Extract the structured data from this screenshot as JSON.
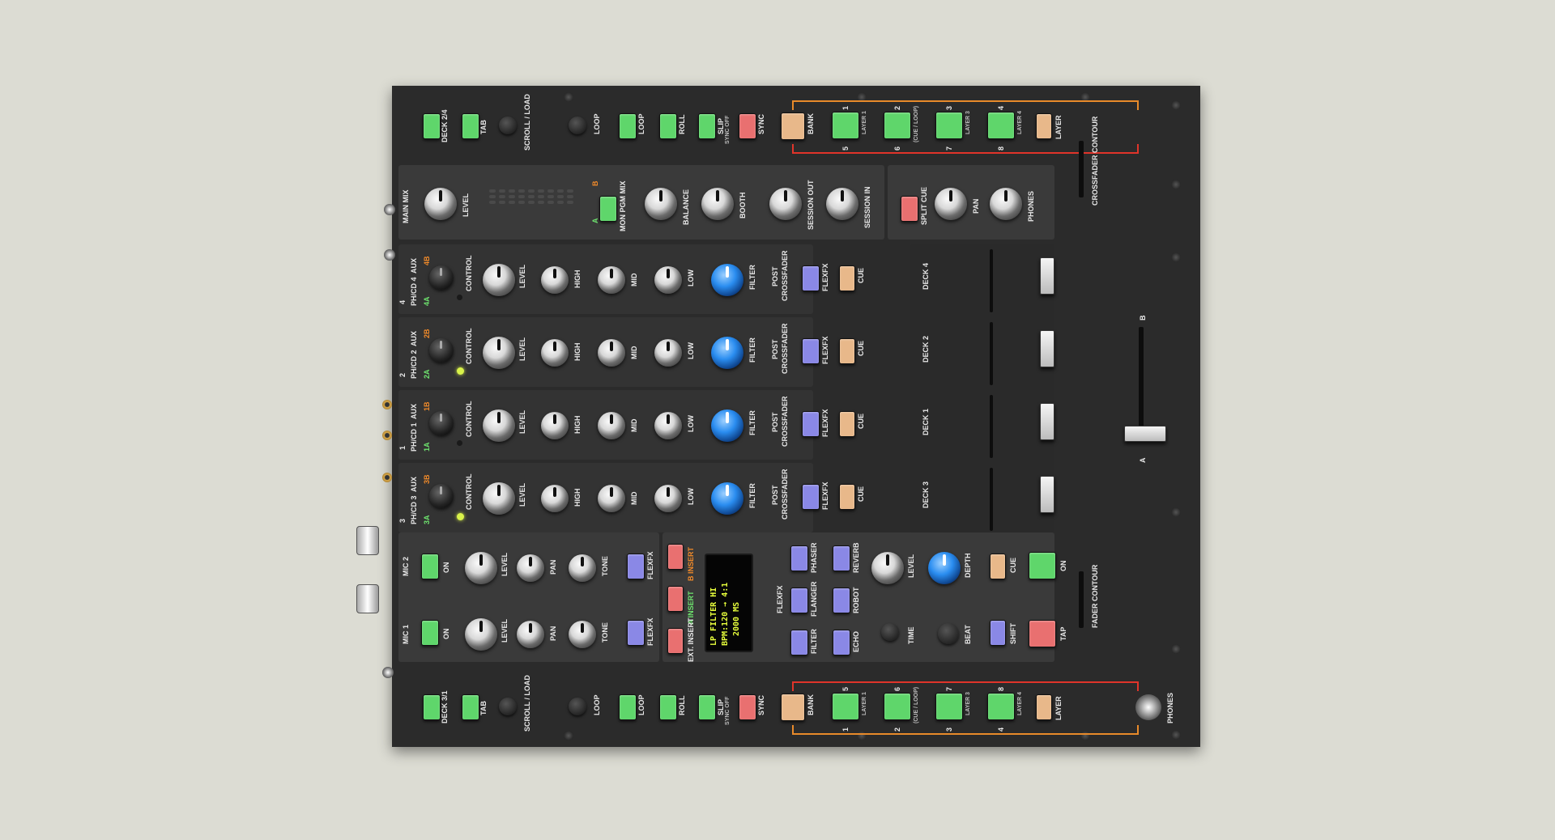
{
  "colors": {
    "accent_green": "#5fd66b",
    "accent_peach": "#e8b88a",
    "accent_red": "#e97070",
    "accent_purple": "#8a88e6",
    "accent_blue": "#2a8df0",
    "bracket_orange": "#e88a2a",
    "bracket_red": "#e0342a",
    "display_yellow": "#e8ff3c"
  },
  "top_deck": {
    "deck_label": "DECK 2/4",
    "tab": "TAB",
    "scroll": "SCROLL / LOAD",
    "loop": "LOOP",
    "loop2": "LOOP",
    "roll": "ROLL",
    "slip": "SLIP",
    "slip_sub": "SYNC OFF",
    "sync": "SYNC",
    "bank": "BANK",
    "pads": [
      {
        "top": "1",
        "bottom": "5",
        "sub": "LAYER 1"
      },
      {
        "top": "2",
        "bottom": "6",
        "sub": "(CUE / LOOP)"
      },
      {
        "top": "3",
        "bottom": "7",
        "sub": "LAYER 3"
      },
      {
        "top": "4",
        "bottom": "8",
        "sub": "LAYER 4"
      }
    ],
    "layer": "LAYER"
  },
  "bottom_deck": {
    "deck_label": "DECK 3/1",
    "tab": "TAB",
    "scroll": "SCROLL / LOAD",
    "loop": "LOOP",
    "loop2": "LOOP",
    "roll": "ROLL",
    "slip": "SLIP",
    "slip_sub": "SYNC OFF",
    "sync": "SYNC",
    "bank": "BANK",
    "pads": [
      {
        "top": "5",
        "bottom": "1",
        "sub": "LAYER 1"
      },
      {
        "top": "6",
        "bottom": "2",
        "sub": "(CUE / LOOP)"
      },
      {
        "top": "7",
        "bottom": "3",
        "sub": "LAYER 3"
      },
      {
        "top": "8",
        "bottom": "4",
        "sub": "LAYER 4"
      }
    ],
    "layer": "LAYER",
    "phones": "PHONES"
  },
  "master": {
    "main_mix": "MAIN MIX",
    "level": "LEVEL",
    "mon_pgm_mix": "MON PGM MIX",
    "src_a": "A",
    "src_b": "B",
    "balance": "BALANCE",
    "booth": "BOOTH",
    "session_out": "SESSION OUT",
    "session_in": "SESSION IN",
    "split_cue": "SPLIT CUE",
    "pan": "PAN",
    "phones": "PHONES",
    "crossfader_contour": "CROSSFADER CONTOUR"
  },
  "channels": [
    {
      "num": "4",
      "src": "PH/CD 4",
      "aux": "AUX",
      "tag_top": "4B",
      "tag_bottom": "4A",
      "control": "CONTROL",
      "led_on": false
    },
    {
      "num": "2",
      "src": "PH/CD 2",
      "aux": "AUX",
      "tag_top": "2B",
      "tag_bottom": "2A",
      "control": "CONTROL",
      "led_on": true
    },
    {
      "num": "1",
      "src": "PH/CD 1",
      "aux": "AUX",
      "tag_top": "1B",
      "tag_bottom": "1A",
      "control": "CONTROL",
      "led_on": false
    },
    {
      "num": "3",
      "src": "PH/CD 3",
      "aux": "AUX",
      "tag_top": "3B",
      "tag_bottom": "3A",
      "control": "CONTROL",
      "led_on": true
    }
  ],
  "strip": {
    "level": "LEVEL",
    "high": "HIGH",
    "mid": "MID",
    "low": "LOW",
    "filter": "FILTER",
    "post": "POST",
    "crossfader": "CROSSFADER",
    "flexfx": "FLEXFX",
    "cue": "CUE",
    "a": "A",
    "b": "B"
  },
  "decks": [
    "DECK 4",
    "DECK 2",
    "DECK 1",
    "DECK 3"
  ],
  "xfader": {
    "a": "A",
    "b": "B"
  },
  "mics": [
    {
      "name": "MIC 2",
      "on": "ON",
      "level": "LEVEL",
      "pan": "PAN",
      "tone": "TONE",
      "flexfx": "FLEXFX"
    },
    {
      "name": "MIC 1",
      "on": "ON",
      "level": "LEVEL",
      "pan": "PAN",
      "tone": "TONE",
      "flexfx": "FLEXFX"
    }
  ],
  "fx": {
    "insert_a": "A INSERT",
    "insert_b": "B INSERT",
    "ext_insert": "EXT. INSERT",
    "display_lines": [
      "LP FILTER HI",
      "BPM:120 → 4:1",
      "2000 MS"
    ],
    "flexfx": "FLEXFX",
    "phaser": "PHASER",
    "reverb": "REVERB",
    "flanger": "FLANGER",
    "robot": "ROBOT",
    "filter": "FILTER",
    "echo": "ECHO",
    "level": "LEVEL",
    "depth": "DEPTH",
    "cue": "CUE",
    "on": "ON",
    "time": "TIME",
    "beat": "BEAT",
    "shift": "SHIFT",
    "tap": "TAP",
    "fader_contour": "FADER CONTOUR"
  }
}
